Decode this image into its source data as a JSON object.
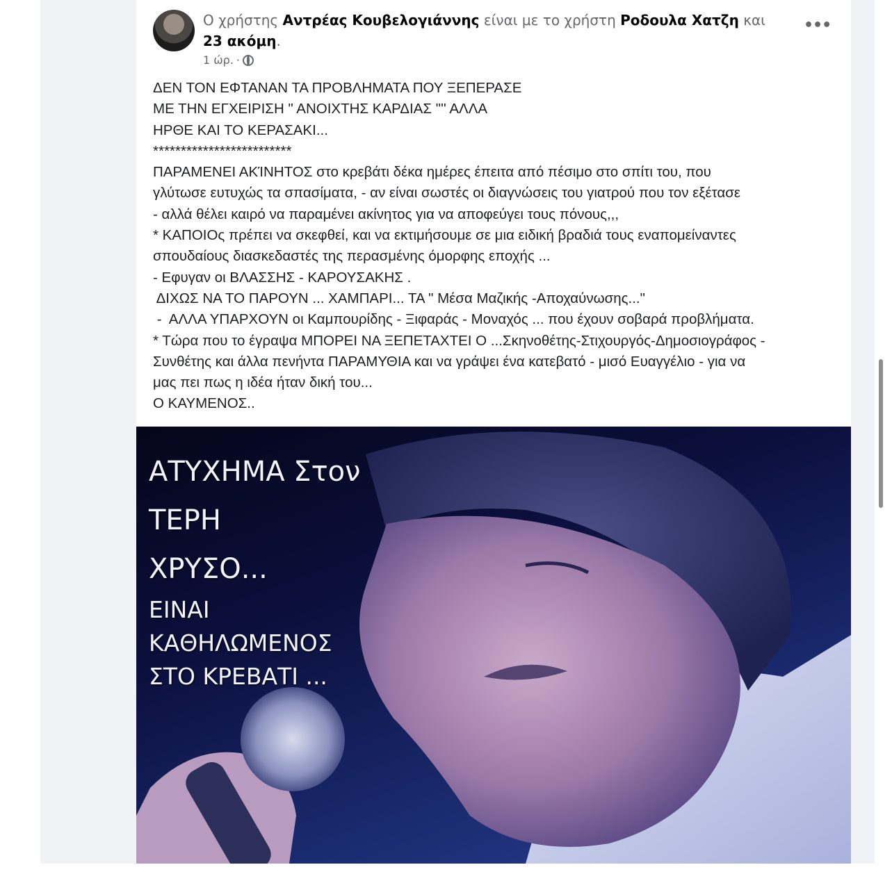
{
  "post": {
    "header": {
      "prefix": "Ο χρήστης",
      "author": "Αντρέας Κουβελογιάννης",
      "middle": "είναι με το χρήστη",
      "tagged": "Ροδουλα Χατζη",
      "and": "και",
      "others": "23 ακόμη",
      "period": "."
    },
    "time": "1 ώρ.",
    "separator": "·",
    "privacy_icon": "globe-icon",
    "more_icon": "more-options-icon",
    "more_label": "•••",
    "body_lines": [
      "ΔΕΝ ΤΟΝ ΕΦΤΑΝΑΝ ΤΑ ΠΡΟΒΛΗΜΑΤΑ ΠΟΥ ΞΕΠΕΡΑΣΕ",
      "ΜΕ ΤΗΝ ΕΓΧΕΙΡΙΣΗ \" ΑΝΟΙΧΤΗΣ ΚΑΡΔΙΑΣ \"'' ΑΛΛΑ",
      "ΗΡΘΕ ΚΑΙ ΤΟ ΚΕΡΑΣΑΚΙ...",
      "*************************",
      "ΠΑΡΑΜΕΝΕΙ ΑΚΊΝΗΤΟΣ στο κρεβάτι δέκα ημέρες έπειτα από πέσιμο στο σπίτι του, που",
      "γλύτωσε ευτυχώς τα σπασίματα, - αν είναι σωστές οι διαγνώσεις του γιατρού που τον εξέτασε",
      "- αλλά θέλει καιρό να παραμένει ακίνητος για να αποφεύγει τους πόνους,,,",
      "* ΚΑΠΟΙΟς πρέπει να σκεφθεί, και να εκτιμήσουμε σε μια ειδική βραδιά τους εναπομείναντες",
      "σπουδαίους διασκεδαστές της περασμένης όμορφης εποχής ...",
      "- Εφυγαν οι ΒΛΑΣΣΗΣ - ΚΑΡΟΥΣΑΚΗΣ .",
      " ΔΙΧΩΣ ΝΑ ΤΟ ΠΑΡΟΥΝ ... ΧΑΜΠΑΡΙ... ΤΑ \" Μέσα Μαζικής -Αποχαύνωσης...\"",
      " -  ΑΛΛΑ ΥΠΑΡΧΟΥΝ οι Καμπουρίδης - Ξιφαράς - Μοναχός ... που έχουν σοβαρά προβλήματα.",
      "* Τώρα που το έγραψα ΜΠΟΡΕΙ ΝΑ ΞΕΠΕΤΑΧΤΕΙ Ο ...Σκηνοθέτης-Στιχουργός-Δημοσιογράφος -",
      "Συνθέτης και άλλα πενήντα ΠΑΡΑΜΥΘΙΑ και να γράψει ένα κατεβατό - μισό Ευαγγέλιο - για να",
      "μας πει πως η ιδέα ήταν δική του...",
      "Ο ΚΑΥΜΕΝΟΣ.."
    ],
    "photo": {
      "line1": "ΑΤΥΧΗΜΑ  Στον",
      "line2": "ΤΕΡΗ",
      "line3": "ΧΡΥΣΟ...",
      "line4": "ΕΙΝΑΙ",
      "line5": "ΚΑΘΗΛΩΜΕΝΟΣ",
      "line6": "ΣΤΟ ΚΡΕΒΑΤΙ ..."
    }
  }
}
